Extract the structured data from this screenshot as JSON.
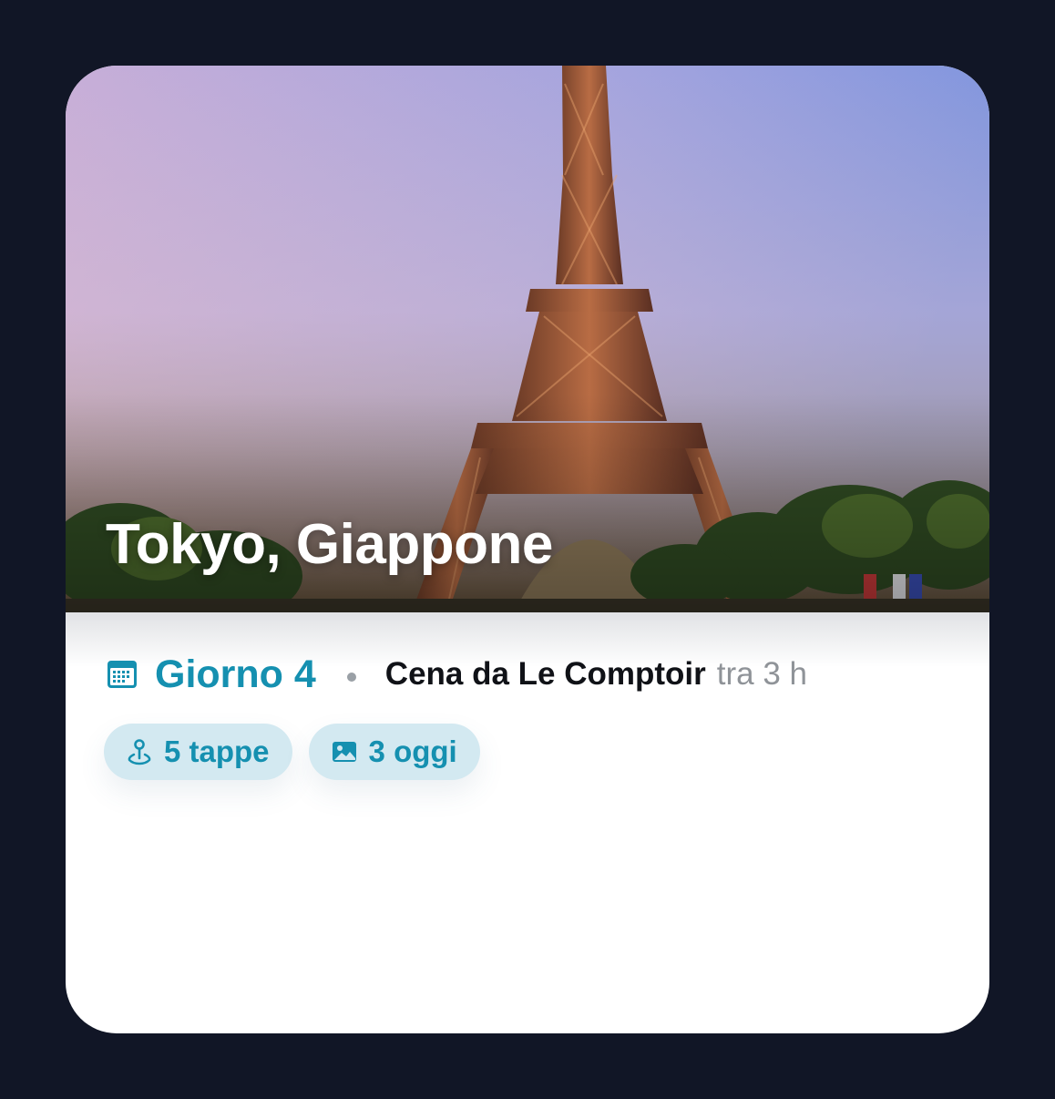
{
  "hero": {
    "title": "Tokyo, Giappone"
  },
  "trip": {
    "day_label": "Giorno 4",
    "next_event": "Cena da Le Comptoir",
    "eta": "tra 3 h"
  },
  "chips": [
    {
      "label": "5 tappe",
      "icon": "map-pin-icon"
    },
    {
      "label": "3 oggi",
      "icon": "image-icon"
    }
  ],
  "colors": {
    "accent": "#1590b0",
    "chip_background": "#d3e9f1",
    "page_background": "#111626"
  }
}
